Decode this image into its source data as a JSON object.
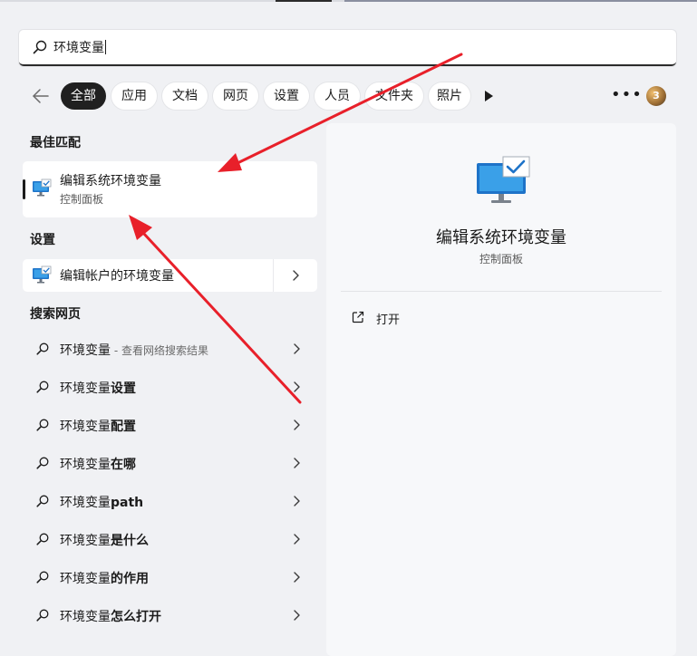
{
  "search": {
    "value": "环境变量"
  },
  "filters": [
    "全部",
    "应用",
    "文档",
    "网页",
    "设置",
    "人员",
    "文件夹",
    "照片"
  ],
  "more_label": "•••",
  "avatar_label": "3",
  "sections": {
    "best_match": "最佳匹配",
    "settings": "设置",
    "web": "搜索网页"
  },
  "best_match": {
    "title": "编辑系统环境变量",
    "subtitle": "控制面板"
  },
  "setting_item": {
    "title": "编辑帐户的环境变量"
  },
  "web_results": [
    {
      "prefix": "环境变量",
      "suffix": "",
      "hint": " - 查看网络搜索结果"
    },
    {
      "prefix": "环境变量",
      "suffix": "设置",
      "hint": ""
    },
    {
      "prefix": "环境变量",
      "suffix": "配置",
      "hint": ""
    },
    {
      "prefix": "环境变量",
      "suffix": "在哪",
      "hint": ""
    },
    {
      "prefix": "环境变量",
      "suffix": "path",
      "hint": ""
    },
    {
      "prefix": "环境变量",
      "suffix": "是什么",
      "hint": ""
    },
    {
      "prefix": "环境变量",
      "suffix": "的作用",
      "hint": ""
    },
    {
      "prefix": "环境变量",
      "suffix": "怎么打开",
      "hint": ""
    }
  ],
  "preview": {
    "title": "编辑系统环境变量",
    "subtitle": "控制面板",
    "open_label": "打开"
  },
  "colors": {
    "accent": "#1e73c8",
    "annotation_arrow": "#e8202a"
  }
}
